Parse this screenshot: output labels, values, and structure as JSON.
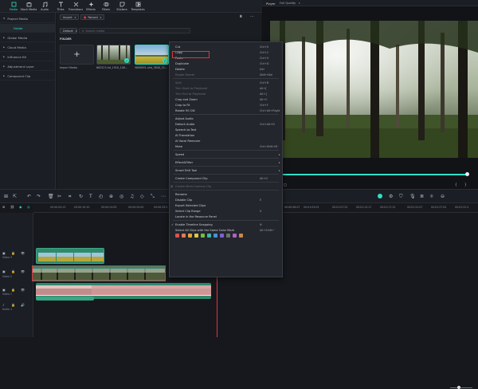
{
  "top_tabs": [
    {
      "label": "Media",
      "icon": "media-icon",
      "active": true
    },
    {
      "label": "Stock Media",
      "icon": "stock-media-icon",
      "active": false
    },
    {
      "label": "Audio",
      "icon": "audio-icon",
      "active": false
    },
    {
      "label": "Titles",
      "icon": "titles-icon",
      "active": false
    },
    {
      "label": "Transitions",
      "icon": "transitions-icon",
      "active": false
    },
    {
      "label": "Effects",
      "icon": "effects-icon",
      "active": false
    },
    {
      "label": "Filters",
      "icon": "filters-icon",
      "active": false
    },
    {
      "label": "Stickers",
      "icon": "stickers-icon",
      "active": false
    },
    {
      "label": "Templates",
      "icon": "templates-icon",
      "active": false
    }
  ],
  "sidebar": {
    "items": [
      {
        "label": "Project Media",
        "expanded": true
      },
      {
        "label": "Folder",
        "selected": true
      },
      {
        "label": "Global Media",
        "expanded": false
      },
      {
        "label": "Cloud Media",
        "expanded": false
      },
      {
        "label": "Influence Kit",
        "expanded": false
      },
      {
        "label": "Adjustment Layer",
        "expanded": false
      },
      {
        "label": "Compound Clip",
        "expanded": false
      }
    ]
  },
  "media": {
    "import_label": "Import",
    "record_label": "Record",
    "sort_label": "Default",
    "search_placeholder": "Search media",
    "folder_label": "FOLDER",
    "import_media_label": "Import Media",
    "items": [
      {
        "name": "682523-hd_1920_108..."
      },
      {
        "name": "5809891-uhd_3840_21..."
      }
    ]
  },
  "player": {
    "title": "Player",
    "quality": "Full Quality"
  },
  "context_menu": {
    "items": [
      {
        "label": "Cut",
        "shortcut": "Ctrl+X",
        "disabled": false
      },
      {
        "label": "Copy",
        "shortcut": "Ctrl+C",
        "disabled": false,
        "highlight": true
      },
      {
        "label": "Paste",
        "shortcut": "Ctrl+V",
        "disabled": false
      },
      {
        "label": "Duplicate",
        "shortcut": "Ctrl+D",
        "disabled": false
      },
      {
        "label": "Delete",
        "shortcut": "Del",
        "disabled": false
      },
      {
        "label": "Ripple Delete",
        "shortcut": "Shift+Del",
        "disabled": true
      },
      {
        "sep": true
      },
      {
        "label": "Split",
        "shortcut": "Ctrl+B",
        "disabled": true
      },
      {
        "label": "Trim Start to Playhead",
        "shortcut": "Alt+[",
        "disabled": true
      },
      {
        "label": "Trim End to Playhead",
        "shortcut": "Alt+]",
        "disabled": true
      },
      {
        "label": "Crop and Zoom",
        "shortcut": "Alt+C",
        "disabled": false
      },
      {
        "label": "Crop to Fit",
        "shortcut": "Ctrl+F",
        "disabled": false
      },
      {
        "label": "Rotate 90 CW",
        "shortcut": "Ctrl+Alt+Right",
        "disabled": false
      },
      {
        "sep": true
      },
      {
        "label": "Adjust Audio",
        "shortcut": "",
        "disabled": false
      },
      {
        "label": "Detach Audio",
        "shortcut": "Ctrl+Alt+D",
        "disabled": false
      },
      {
        "label": "Speech-to-Text",
        "shortcut": "",
        "disabled": false
      },
      {
        "label": "AI Translation",
        "shortcut": "",
        "disabled": false
      },
      {
        "label": "AI Vocal Remover",
        "shortcut": "",
        "disabled": false
      },
      {
        "label": "Mute",
        "shortcut": "Ctrl+Shift+M",
        "disabled": false
      },
      {
        "sep": true
      },
      {
        "label": "Speed",
        "shortcut": "",
        "disabled": false,
        "submenu": true
      },
      {
        "sep": true
      },
      {
        "label": "Effect&Filter",
        "shortcut": "",
        "disabled": false,
        "submenu": true
      },
      {
        "sep": true
      },
      {
        "label": "Smart Edit Tool",
        "shortcut": "",
        "disabled": false,
        "submenu": true
      },
      {
        "sep": true
      },
      {
        "label": "Create Compound Clip",
        "shortcut": "Alt+G",
        "disabled": false
      },
      {
        "sep": true
      },
      {
        "label": "Create Multi-Camera Clip",
        "shortcut": "",
        "disabled": true
      },
      {
        "sep": true
      },
      {
        "label": "Rename",
        "shortcut": "",
        "disabled": false
      },
      {
        "label": "Disable Clip",
        "shortcut": "E",
        "disabled": false
      },
      {
        "label": "Export Selected Clips",
        "shortcut": "",
        "disabled": false
      },
      {
        "label": "Select Clip Range",
        "shortcut": "X",
        "disabled": false
      },
      {
        "label": "Locate in the Resource Panel",
        "shortcut": "",
        "disabled": false
      },
      {
        "sep": true
      },
      {
        "label": "Enable Timeline Snapping",
        "shortcut": "N",
        "disabled": false,
        "checked": true
      },
      {
        "label": "Select All Clips with the Same Color Mark",
        "shortcut": "Alt+Shift+`",
        "disabled": false
      }
    ],
    "color_marks": [
      "#d9534f",
      "#e07b5a",
      "#e0a53a",
      "#d4c94a",
      "#6cc04a",
      "#3fb6a8",
      "#4a8fd9",
      "#7d5fd6",
      "#6f6f6f",
      "#b05fc4",
      "#c7894a"
    ]
  },
  "ruler": {
    "labels": [
      "00:00:04:13",
      "00:00:19:10",
      "00:00:24:05",
      "00:00:29:00",
      "00:00:33:2",
      "00:00:58:07",
      "00:01:03:03",
      "00:01:07:22",
      "00:01:12:17",
      "00:01:17:12",
      "00:01:22:07",
      "00:01:27:02",
      "00:01:31:2"
    ]
  },
  "tracks": [
    {
      "label": "Video 3"
    },
    {
      "label": "Video 2"
    },
    {
      "label": "Video 1"
    },
    {
      "label": "Audio 1"
    }
  ],
  "colors": {
    "accent": "#2ee0c7",
    "menu_bg": "#23262c",
    "highlight_box": "#e0363c",
    "clip_green": "#2f8a6c"
  }
}
